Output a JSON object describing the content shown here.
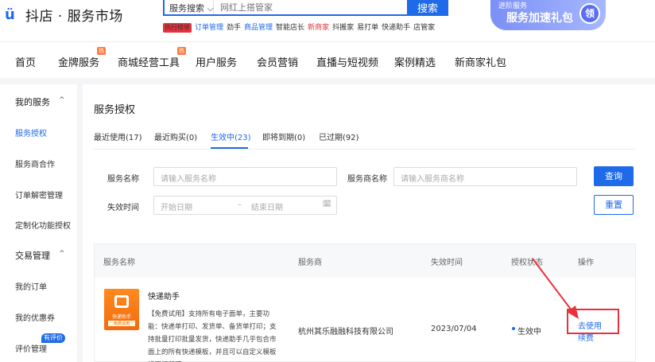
{
  "header": {
    "logo_mark": "ü",
    "logo_text": "抖店 · 服务市场",
    "search_select": "服务搜索 ⌵",
    "search_placeholder": "网红上搭管家",
    "search_button": "搜索",
    "hot_tag": "热行榜单",
    "hot_links": [
      {
        "label": "订单管理",
        "style": "blue"
      },
      {
        "label": "劲手",
        "style": "normal"
      },
      {
        "label": "商品管理",
        "style": "blue"
      },
      {
        "label": "智能店长",
        "style": "normal"
      },
      {
        "label": "新商家",
        "style": "red"
      },
      {
        "label": "抖搬家",
        "style": "normal"
      },
      {
        "label": "易打单",
        "style": "normal"
      },
      {
        "label": "快递助手",
        "style": "normal"
      },
      {
        "label": "店管家",
        "style": "normal"
      }
    ],
    "banner_small": "进阶服务",
    "banner_big": "服务加速礼包",
    "banner_circle": "领"
  },
  "topnav": {
    "items": [
      "首页",
      "金牌服务",
      "商城经营工具",
      "用户服务",
      "会员营销",
      "直播与短视频",
      "案例精选",
      "新商家礼包"
    ],
    "badge": "热"
  },
  "sidebar": {
    "groups": [
      {
        "label": "我的服务",
        "caret": "^",
        "items": [
          "服务授权",
          "服务商合作",
          "订单解密管理",
          "定制化功能授权"
        ]
      },
      {
        "label": "交易管理",
        "caret": "^",
        "items": [
          "我的订单",
          "我的优惠券",
          "评价管理"
        ]
      }
    ],
    "active": "服务授权",
    "new_badge": "有评价"
  },
  "main": {
    "title": "服务授权",
    "tabs": [
      {
        "label": "最近使用(17)"
      },
      {
        "label": "最近购买(0)"
      },
      {
        "label": "生效中(23)"
      },
      {
        "label": "即将到期(0)"
      },
      {
        "label": "已过期(92)"
      }
    ],
    "filters": {
      "service_name_label": "服务名称",
      "service_name_placeholder": "请输入服务名称",
      "provider_label": "服务商名称",
      "provider_placeholder": "请输入服务商名称",
      "expire_label": "失效时间",
      "start_placeholder": "开始日期",
      "range_sep": "–",
      "end_placeholder": "结束日期",
      "calendar_icon": "🗓"
    },
    "query_button": "查询",
    "reset_button": "重置",
    "table": {
      "headers": [
        "服务名称",
        "服务商",
        "失效时间",
        "授权状态",
        "操作"
      ],
      "row": {
        "thumb_label": "快递助手",
        "thumb_sub": "免费试用",
        "name": "快递助手",
        "desc": "【免费试用】支持所有电子面单，主要功能：快递单打印、发货单、备货单打印；支持批量打印批量发货，快递助手几乎包合市面上的所有快递模板，并且可以自定义模板设置打印项。",
        "provider": "杭州其乐融融科技有限公司",
        "expire": "2023/07/04",
        "status": "生效中",
        "op_use": "去使用",
        "op_renew": "续费"
      }
    }
  }
}
